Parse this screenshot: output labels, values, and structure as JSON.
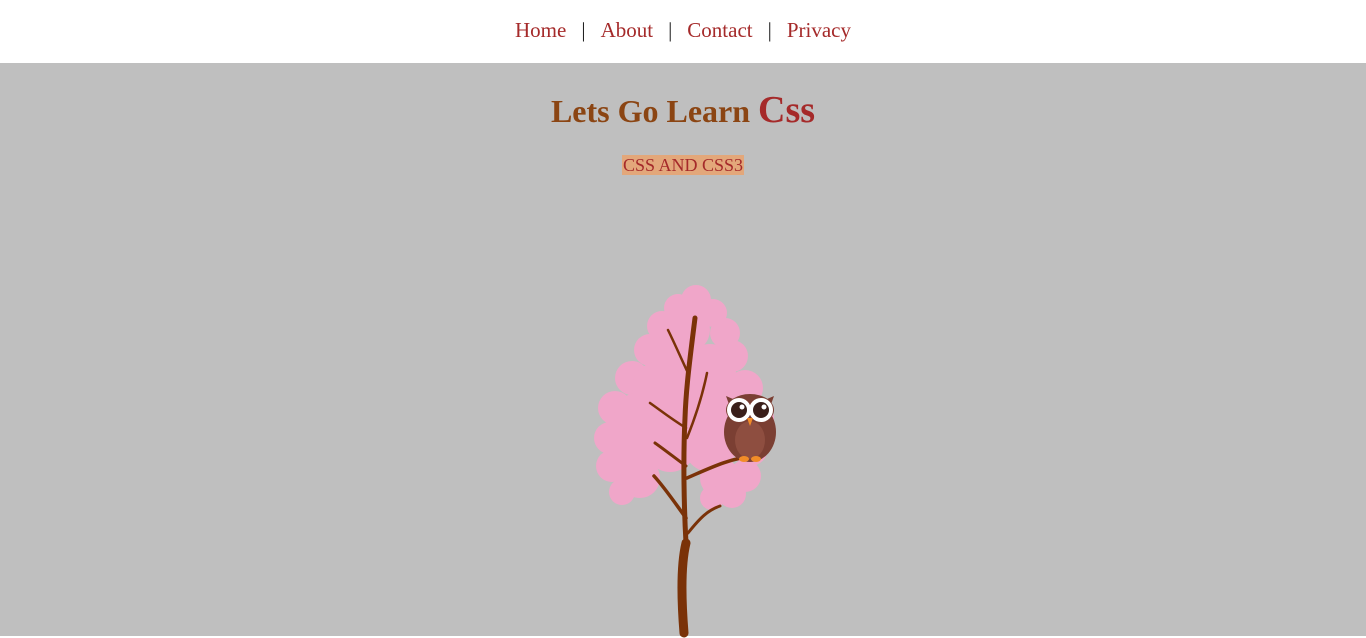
{
  "nav": {
    "items": [
      {
        "label": "Home"
      },
      {
        "label": "About"
      },
      {
        "label": "Contact"
      },
      {
        "label": "Privacy"
      }
    ],
    "separator": "|"
  },
  "hero": {
    "title_main": "Lets Go Learn ",
    "title_accent": "Css",
    "subtitle": "CSS AND CSS3"
  },
  "colors": {
    "link": "#a52a2a",
    "title": "#8b4513",
    "background": "#bfbfbf",
    "subtitle_highlight": "#e3a77a"
  },
  "illustration": {
    "icons": [
      "tree-icon",
      "owl-icon"
    ]
  }
}
